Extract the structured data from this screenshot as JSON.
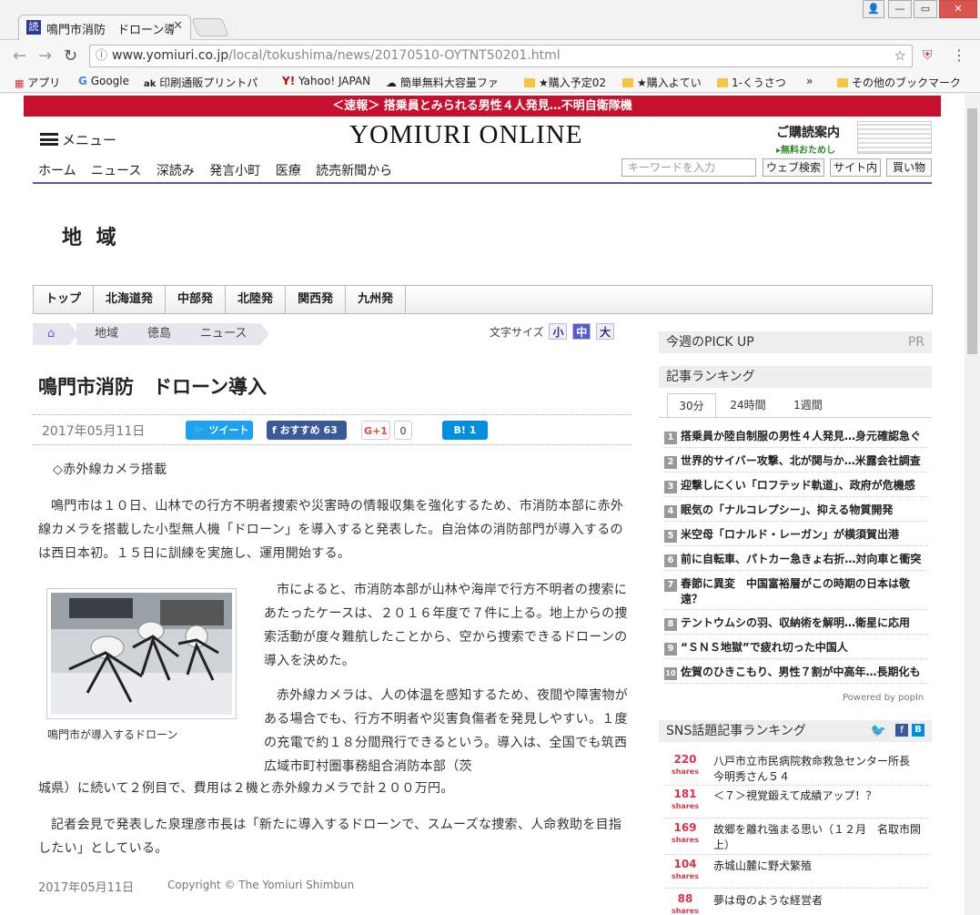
{
  "browser": {
    "tab_title": "鳴門市消防　ドローン導",
    "tab_favicon": "読",
    "url_domain": "www.yomiuri.co.jp",
    "url_path": "/local/tokushima/news/20170510-OYTNT50201.html",
    "bookmarks": [
      "アプリ",
      "Google",
      "印刷通販プリントパ",
      "Yahoo! JAPAN",
      "簡単無料大容量ファ",
      "★購入予定02",
      "★購入よてい",
      "1-くうさつ",
      "»",
      "その他のブックマーク"
    ]
  },
  "site": {
    "breaking": "＜速報＞ 搭乗員とみられる男性４人発見…不明自衛隊機",
    "menu_label": "メニュー",
    "logo": "YOMIURI ONLINE",
    "subscribe_label": "ご購読案内",
    "subscribe_sub": "▸無料おためし",
    "nav": [
      "ホーム",
      "ニュース",
      "深読み",
      "発言小町",
      "医療",
      "読売新聞から"
    ],
    "search_placeholder": "キーワードを入力",
    "search_buttons": [
      "ウェブ検索",
      "サイト内",
      "買い物"
    ],
    "section_title": "地 域",
    "region_tabs": [
      "トップ",
      "北海道発",
      "中部発",
      "北陸発",
      "関西発",
      "九州発"
    ],
    "breadcrumb": [
      "地域",
      "徳島",
      "ニュース"
    ],
    "font_size_label": "文字サイズ",
    "font_sizes": [
      "小",
      "中",
      "大"
    ]
  },
  "article": {
    "headline": "鳴門市消防　ドローン導入",
    "date": "2017年05月11日",
    "share": {
      "tweet": "ツイート",
      "fb": "おすすめ",
      "fb_count": "63",
      "gplus": "G+1",
      "gplus_count": "0",
      "hatena": "B!",
      "hatena_count": "1"
    },
    "subhead": "◇赤外線カメラ搭載",
    "p1": "鳴門市は１０日、山林での行方不明者捜索や災害時の情報収集を強化するため、市消防本部に赤外線カメラを搭載した小型無人機「ドローン」を導入すると発表した。自治体の消防部門が導入するのは西日本初。１５日に訓練を実施し、運用開始する。",
    "p2": "市によると、市消防本部が山林や海岸で行方不明者の捜索にあたったケースは、２０１６年度で７件に上る。地上からの捜索活動が度々難航したことから、空から捜索できるドローンの導入を決めた。",
    "p3a": "赤外線カメラは、人の体温を感知するため、夜間や障害物がある場合でも、行方不明者や災害負傷者を発見しやすい。１度の充電で約１８分間飛行できるという。導入は、全国でも筑西広域市町村圏事務組合消防本部（茨",
    "p3b": "城県）に続いて２例目で、費用は２機と赤外線カメラで計２００万円。",
    "p4": "記者会見で発表した泉理彦市長は「新たに導入するドローンで、スムーズな捜索、人命救助を目指したい」としている。",
    "caption": "鳴門市が導入するドローン",
    "footer_date": "2017年05月11日",
    "copyright": "Copyright © The Yomiuri Shimbun"
  },
  "sidebar": {
    "pickup": "今週のPICK UP",
    "pr": "PR",
    "ranking_title": "記事ランキング",
    "ranking_tabs": [
      "30分",
      "24時間",
      "1週間"
    ],
    "ranking": [
      "搭乗員か陸自制服の男性４人発見…身元確認急ぐ",
      "世界的サイバー攻撃、北が関与か…米露会社調査",
      "迎撃しにくい「ロフテッド軌道」、政府が危機感",
      "眠気の「ナルコレプシー」、抑える物質開発",
      "米空母「ロナルド・レーガン」が横須賀出港",
      "前に自転車、パトカー急きょ右折…対向車と衝突",
      "春節に異変　中国富裕層がこの時期の日本は敬遠？",
      "テントウムシの羽、収納術を解明…衛星に応用",
      "“ＳＮＳ地獄”で疲れ切った中国人",
      "佐賀のひきこもり、男性７割が中高年…長期化も"
    ],
    "powered_by": "Powered by popIn",
    "sns_title": "SNS話題記事ランキング",
    "sns": [
      {
        "count": "220",
        "unit": "shares",
        "title": "八戸市立市民病院救命救急センター所長　今明秀さん５４"
      },
      {
        "count": "181",
        "unit": "shares",
        "title": "＜７＞視覚鍛えて成績アップ！？"
      },
      {
        "count": "169",
        "unit": "shares",
        "title": "故郷を離れ強まる思い（１２月　名取市閖上）"
      },
      {
        "count": "104",
        "unit": "shares",
        "title": "赤城山麓に野犬繁殖"
      },
      {
        "count": "88",
        "unit": "shares",
        "title": "夢は母のような経営者"
      }
    ]
  }
}
